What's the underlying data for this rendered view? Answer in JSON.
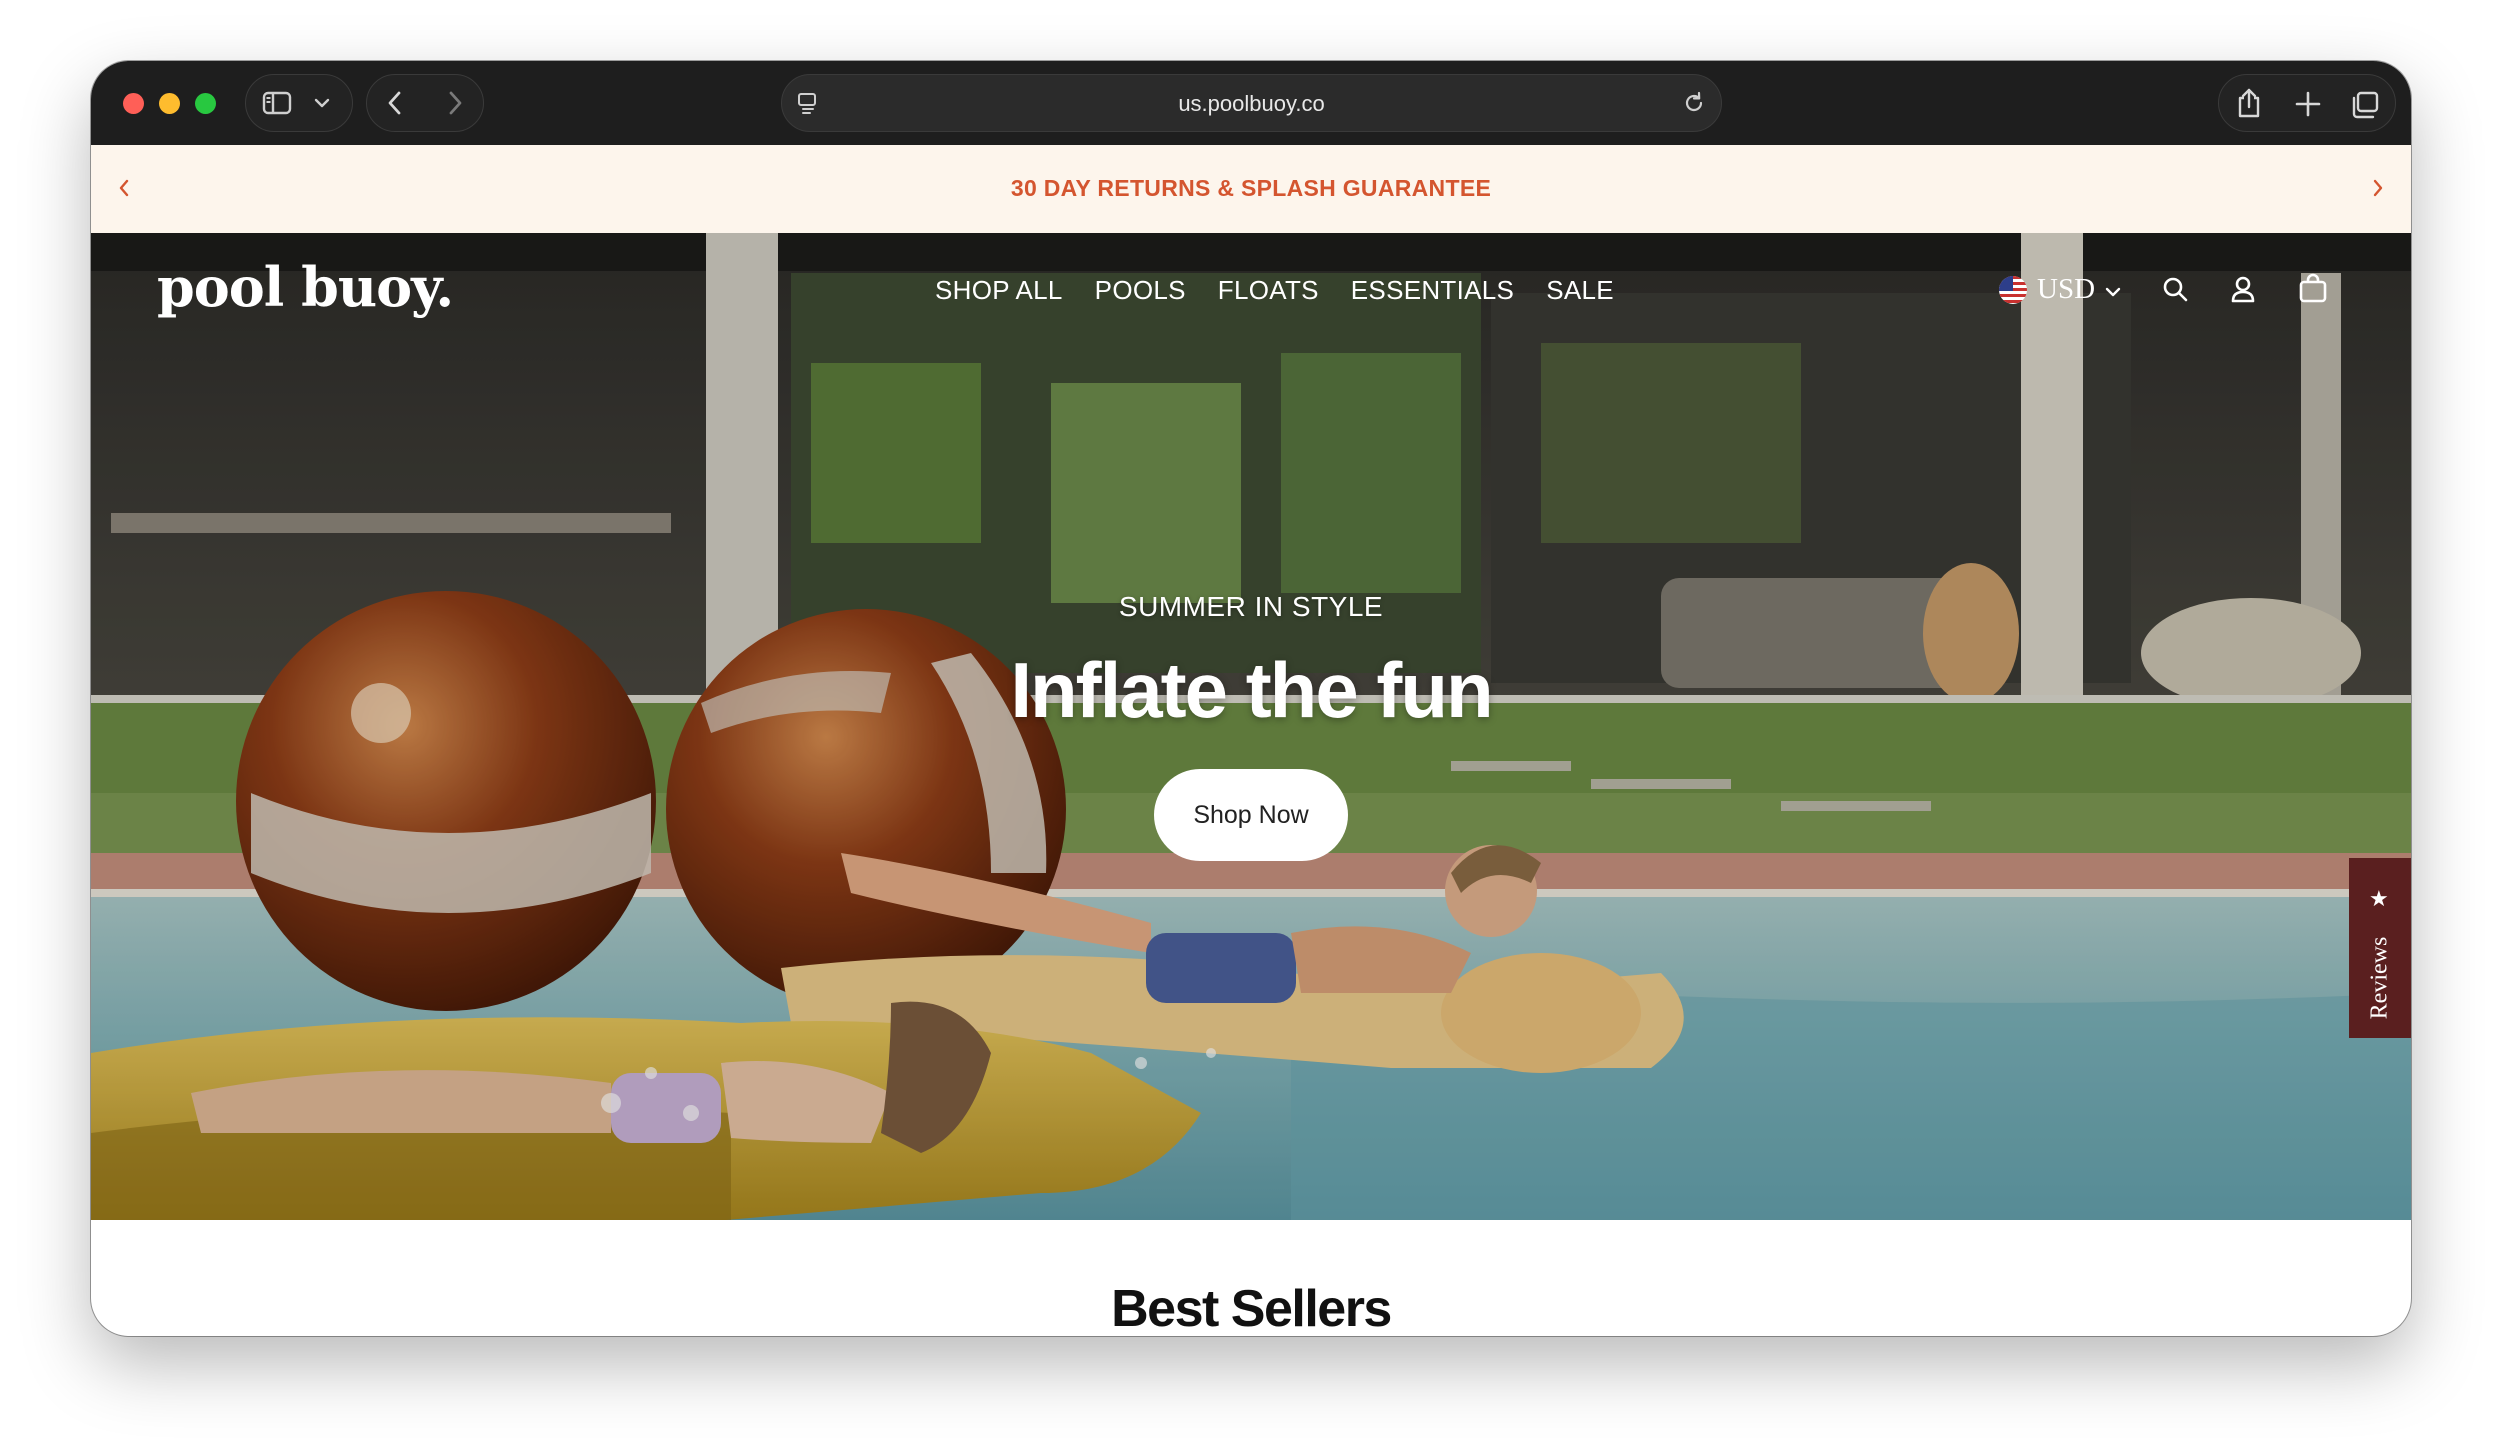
{
  "browser": {
    "url": "us.poolbuoy.co"
  },
  "announcement": {
    "text": "30 DAY RETURNS & SPLASH GUARANTEE"
  },
  "header": {
    "logo": "pool buoy.",
    "nav": [
      {
        "label": "SHOP ALL"
      },
      {
        "label": "POOLS"
      },
      {
        "label": "FLOATS"
      },
      {
        "label": "ESSENTIALS"
      },
      {
        "label": "SALE"
      }
    ],
    "currency": "USD"
  },
  "hero": {
    "kicker": "SUMMER IN STYLE",
    "title": "Inflate the fun",
    "button_label": "Shop Now"
  },
  "reviews_tab": {
    "label": "Reviews"
  },
  "best_sellers": {
    "title": "Best Sellers"
  },
  "colors": {
    "announcement_bg": "#fdf5ec",
    "announcement_text": "#d4552f",
    "reviews_tab": "#5a1f1f"
  }
}
